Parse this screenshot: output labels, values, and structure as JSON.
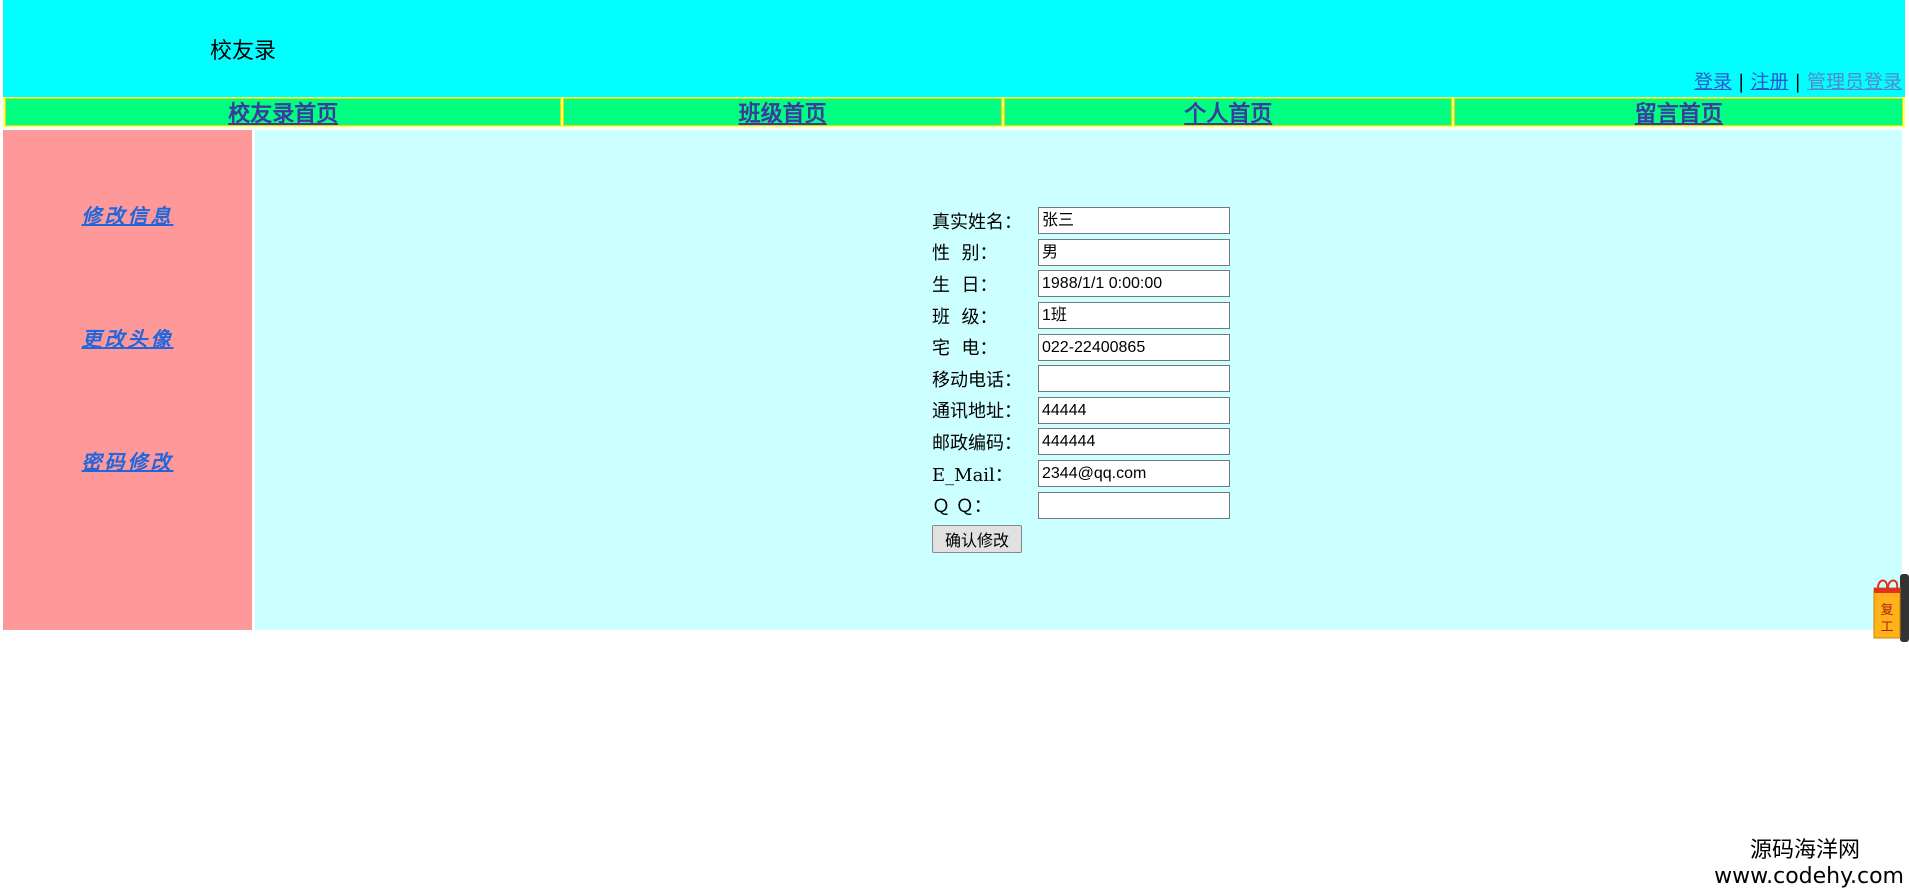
{
  "header": {
    "title": "校友录",
    "auth": {
      "login": "登录",
      "register": "注册",
      "admin_login": "管理员登录",
      "separator": "|"
    }
  },
  "nav": [
    {
      "label": "校友录首页"
    },
    {
      "label": "班级首页"
    },
    {
      "label": "个人首页"
    },
    {
      "label": "留言首页"
    }
  ],
  "sidebar": {
    "items": [
      {
        "label": "修改信息"
      },
      {
        "label": "更改头像"
      },
      {
        "label": "密码修改"
      }
    ]
  },
  "form": {
    "fields": [
      {
        "label": "真实姓名：",
        "value": "张三"
      },
      {
        "label": "性  别：",
        "value": "男"
      },
      {
        "label": "生  日：",
        "value": "1988/1/1 0:00:00"
      },
      {
        "label": "班  级：",
        "value": "1班"
      },
      {
        "label": "宅  电：",
        "value": "022-22400865"
      },
      {
        "label": "移动电话：",
        "value": ""
      },
      {
        "label": "通讯地址：",
        "value": "44444"
      },
      {
        "label": "邮政编码：",
        "value": "444444"
      },
      {
        "label": "E_Mail：",
        "value": "2344@qq.com"
      },
      {
        "label": "Ｑ Ｑ：",
        "value": ""
      }
    ],
    "submit_label": "确认修改"
  },
  "side_tab": {
    "icon": "gift-tab-icon",
    "text": "复工"
  },
  "watermark": {
    "line1": "源码海洋网",
    "line2": "www.codehy.com"
  },
  "colors": {
    "header_bg": "#00ffff",
    "nav_bg": "#00ff80",
    "sidebar_bg": "#ff9999",
    "main_bg": "#ccffff"
  }
}
